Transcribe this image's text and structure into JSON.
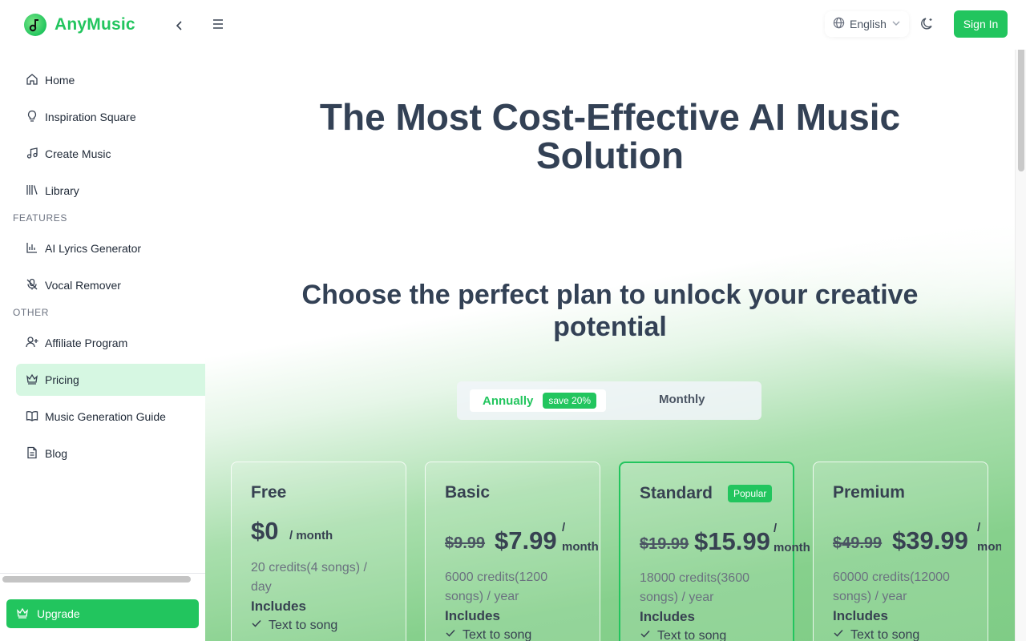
{
  "app": {
    "name": "AnyMusic"
  },
  "header": {
    "language": "English",
    "sign_in": "Sign In"
  },
  "sidebar": {
    "items": [
      {
        "label": "Home",
        "icon": "home-icon"
      },
      {
        "label": "Inspiration Square",
        "icon": "lightbulb-icon"
      },
      {
        "label": "Create Music",
        "icon": "music-note-icon"
      },
      {
        "label": "Library",
        "icon": "library-icon"
      }
    ],
    "features_label": "FEATURES",
    "features": [
      {
        "label": "AI Lyrics Generator",
        "icon": "bar-chart-icon"
      },
      {
        "label": "Vocal Remover",
        "icon": "mic-off-icon"
      }
    ],
    "other_label": "OTHER",
    "other": [
      {
        "label": "Affiliate Program",
        "icon": "user-plus-icon"
      },
      {
        "label": "Pricing",
        "icon": "crown-icon",
        "active": true
      },
      {
        "label": "Music Generation Guide",
        "icon": "book-icon"
      },
      {
        "label": "Blog",
        "icon": "document-icon"
      }
    ],
    "upgrade": "Upgrade"
  },
  "main": {
    "hero_line1": "The Most Cost-Effective AI Music",
    "hero_line2": "Solution",
    "sub_line1": "Choose the perfect plan to unlock your creative",
    "sub_line2": "potential",
    "toggle": {
      "annually": "Annually",
      "save": "save 20%",
      "monthly": "Monthly",
      "selected": "Annually"
    },
    "plans": [
      {
        "name": "Free",
        "price": "$0",
        "per": "/ month",
        "credits_line1": "20 credits(4 songs) /",
        "credits_line2": "day",
        "includes": "Includes",
        "feature": "Text to song"
      },
      {
        "name": "Basic",
        "old_price": "$9.99",
        "price": "$7.99",
        "per_top": "/",
        "per_bottom": "month",
        "credits_line1": "6000 credits(1200",
        "credits_line2": "songs) / year",
        "includes": "Includes",
        "feature": "Text to song"
      },
      {
        "name": "Standard",
        "badge": "Popular",
        "old_price": "$19.99",
        "price": "$15.99",
        "per_top": "/",
        "per_bottom": "month",
        "credits_line1": "18000 credits(3600",
        "credits_line2": "songs) / year",
        "includes": "Includes",
        "feature": "Text to song"
      },
      {
        "name": "Premium",
        "old_price": "$49.99",
        "price": "$39.99",
        "per_top": "/",
        "per_bottom": "month",
        "credits_line1": "60000 credits(12000",
        "credits_line2": "songs) / year",
        "includes": "Includes",
        "feature": "Text to song"
      }
    ]
  },
  "colors": {
    "brand": "#22c55e",
    "active_bg": "#d6f7e2",
    "heading": "#334155"
  }
}
